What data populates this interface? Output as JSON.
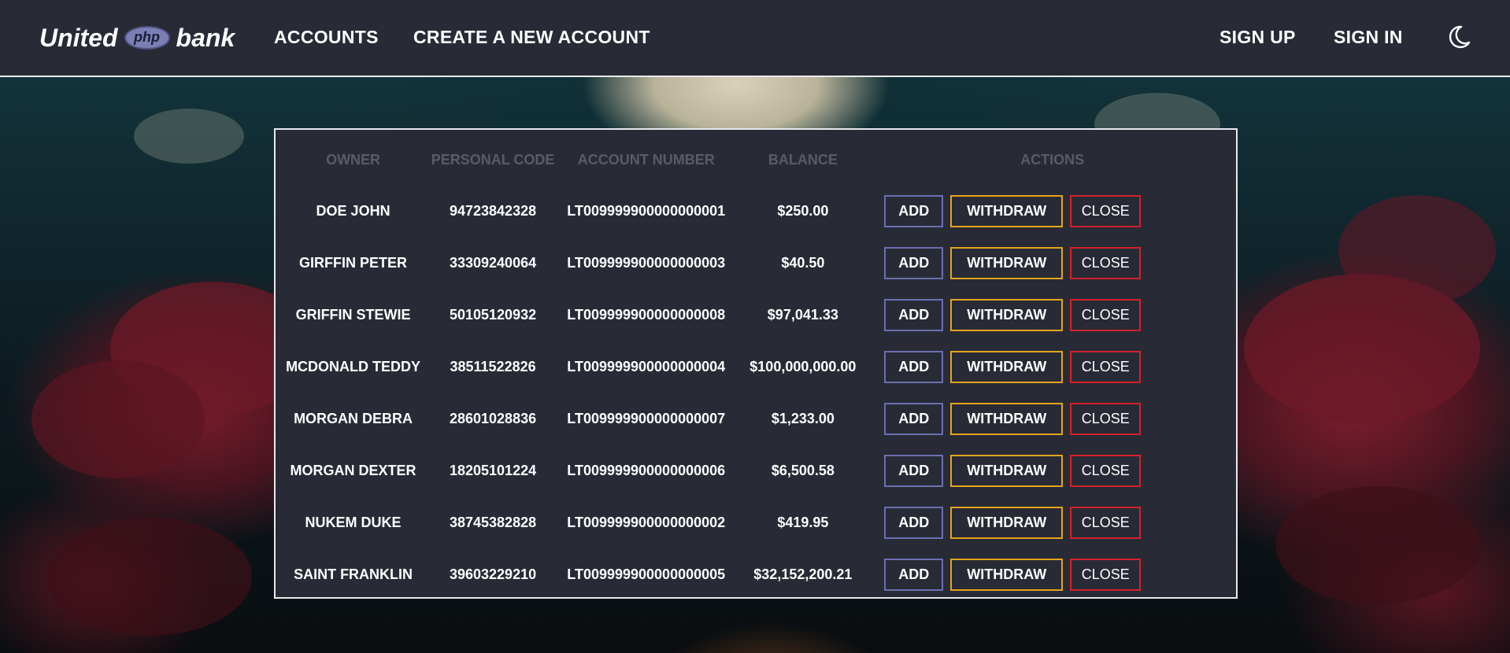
{
  "brand": {
    "left": "United",
    "logo": "php",
    "right": "bank"
  },
  "nav": {
    "accounts": "ACCOUNTS",
    "create": "CREATE A NEW ACCOUNT",
    "signup": "SIGN UP",
    "signin": "SIGN IN",
    "theme_icon": "moon-icon"
  },
  "table": {
    "headers": {
      "owner": "OWNER",
      "code": "PERSONAL CODE",
      "account": "ACCOUNT NUMBER",
      "balance": "BALANCE",
      "actions": "ACTIONS"
    },
    "actions": {
      "add": "ADD",
      "withdraw": "WITHDRAW",
      "close": "CLOSE"
    },
    "rows": [
      {
        "owner": "DOE JOHN",
        "code": "94723842328",
        "account": "LT009999900000000001",
        "balance": "$250.00"
      },
      {
        "owner": "GIRFFIN PETER",
        "code": "33309240064",
        "account": "LT009999900000000003",
        "balance": "$40.50"
      },
      {
        "owner": "GRIFFIN STEWIE",
        "code": "50105120932",
        "account": "LT009999900000000008",
        "balance": "$97,041.33"
      },
      {
        "owner": "MCDONALD TEDDY",
        "code": "38511522826",
        "account": "LT009999900000000004",
        "balance": "$100,000,000.00"
      },
      {
        "owner": "MORGAN DEBRA",
        "code": "28601028836",
        "account": "LT009999900000000007",
        "balance": "$1,233.00"
      },
      {
        "owner": "MORGAN DEXTER",
        "code": "18205101224",
        "account": "LT009999900000000006",
        "balance": "$6,500.58"
      },
      {
        "owner": "NUKEM DUKE",
        "code": "38745382828",
        "account": "LT009999900000000002",
        "balance": "$419.95"
      },
      {
        "owner": "SAINT FRANKLIN",
        "code": "39603229210",
        "account": "LT009999900000000005",
        "balance": "$32,152,200.21"
      }
    ]
  },
  "colors": {
    "navbar_bg": "#282b35",
    "add_border": "#6c6fb0",
    "withdraw_border": "#e5a41d",
    "close_border": "#d4212a"
  }
}
